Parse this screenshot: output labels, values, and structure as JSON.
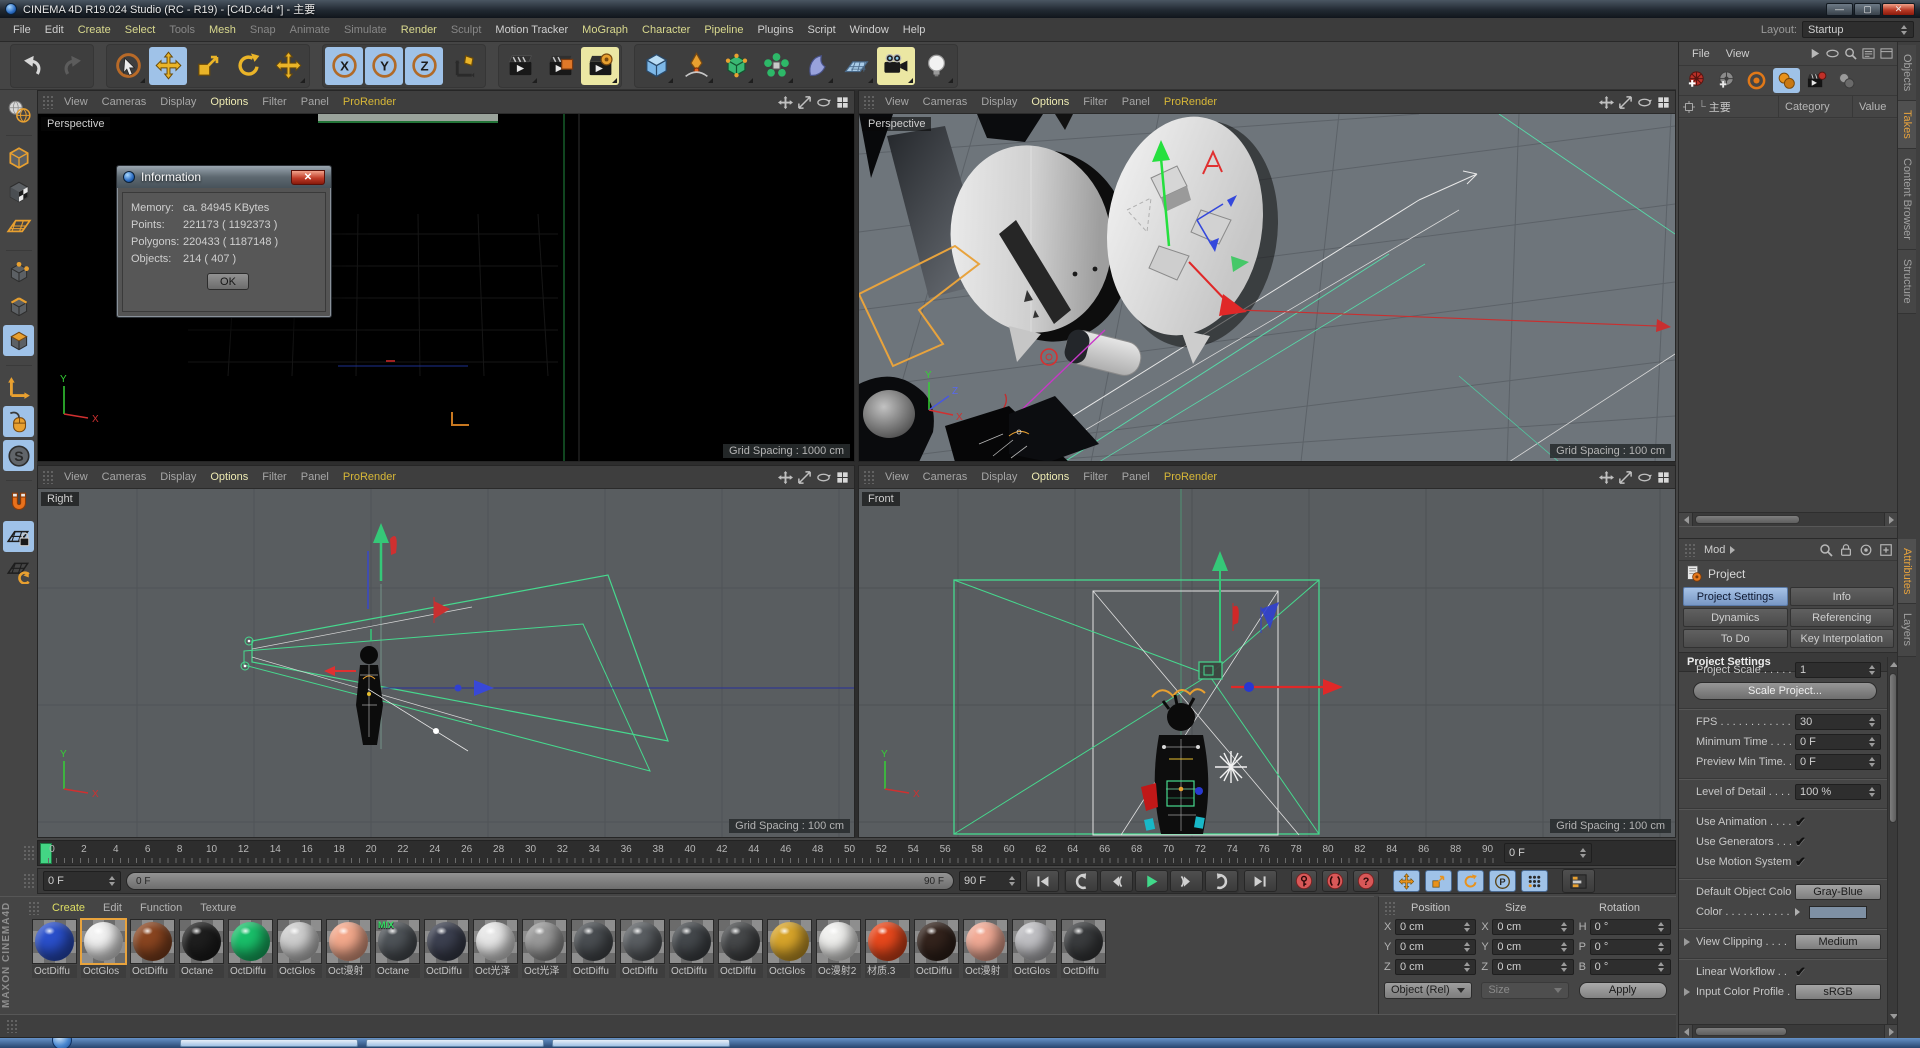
{
  "window": {
    "title": "CINEMA 4D R19.024 Studio (RC - R19) - [C4D.c4d *] - 主要",
    "menu": [
      {
        "label": "File",
        "tone": "normal"
      },
      {
        "label": "Edit",
        "tone": "normal"
      },
      {
        "label": "Create",
        "tone": "accent"
      },
      {
        "label": "Select",
        "tone": "accent"
      },
      {
        "label": "Tools",
        "tone": "dim"
      },
      {
        "label": "Mesh",
        "tone": "accent"
      },
      {
        "label": "Snap",
        "tone": "dim"
      },
      {
        "label": "Animate",
        "tone": "dim"
      },
      {
        "label": "Simulate",
        "tone": "dim"
      },
      {
        "label": "Render",
        "tone": "accent"
      },
      {
        "label": "Sculpt",
        "tone": "dim"
      },
      {
        "label": "Motion Tracker",
        "tone": "normal"
      },
      {
        "label": "MoGraph",
        "tone": "accent"
      },
      {
        "label": "Character",
        "tone": "accent"
      },
      {
        "label": "Pipeline",
        "tone": "accent"
      },
      {
        "label": "Plugins",
        "tone": "normal"
      },
      {
        "label": "Script",
        "tone": "normal"
      },
      {
        "label": "Window",
        "tone": "normal"
      },
      {
        "label": "Help",
        "tone": "normal"
      }
    ],
    "layout_label": "Layout:",
    "layout_value": "Startup",
    "controls": [
      "minimize",
      "maximize",
      "close"
    ]
  },
  "toolbar": {
    "groups": [
      [
        {
          "name": "undo"
        },
        {
          "name": "redo",
          "disabled": true
        }
      ],
      [
        {
          "name": "live-selection",
          "fly": true
        },
        {
          "name": "move",
          "active": true
        },
        {
          "name": "scale"
        },
        {
          "name": "rotate"
        },
        {
          "name": "last-tool",
          "fly": true
        }
      ],
      [
        {
          "name": "lock-x",
          "active": true
        },
        {
          "name": "lock-y",
          "active": true
        },
        {
          "name": "lock-z",
          "active": true
        },
        {
          "name": "coord-system"
        }
      ],
      [
        {
          "name": "render-view",
          "fly": true
        },
        {
          "name": "render-picture-viewer"
        },
        {
          "name": "render-settings",
          "accent": true,
          "fly": true
        }
      ],
      [
        {
          "name": "primitive-cube",
          "fly": true
        },
        {
          "name": "spline-pen",
          "fly": true
        },
        {
          "name": "subdivision-surface",
          "fly": true
        },
        {
          "name": "mograph",
          "fly": true
        },
        {
          "name": "deformer",
          "fly": true
        },
        {
          "name": "floor",
          "fly": true
        },
        {
          "name": "camera",
          "accent": true,
          "fly": true
        },
        {
          "name": "light",
          "fly": true
        }
      ]
    ]
  },
  "left_toolbar": [
    {
      "name": "make-editable"
    },
    {
      "sep": true
    },
    {
      "name": "model-mode"
    },
    {
      "name": "texture-mode"
    },
    {
      "name": "workplane-mode"
    },
    {
      "sep": true
    },
    {
      "name": "points-mode"
    },
    {
      "name": "edges-mode"
    },
    {
      "name": "polygons-mode",
      "active": true
    },
    {
      "sep": true
    },
    {
      "name": "axis-mode"
    },
    {
      "name": "viewport-interaction",
      "active": true
    },
    {
      "name": "snap",
      "active": true
    },
    {
      "sep": true
    },
    {
      "name": "magnet-snap"
    },
    {
      "name": "workplane-lock",
      "active": true
    },
    {
      "name": "planar-workplane"
    }
  ],
  "viewports": {
    "menu": [
      {
        "label": "View",
        "tone": "normal"
      },
      {
        "label": "Cameras",
        "tone": "normal"
      },
      {
        "label": "Display",
        "tone": "normal"
      },
      {
        "label": "Options",
        "tone": "bright"
      },
      {
        "label": "Filter",
        "tone": "normal"
      },
      {
        "label": "Panel",
        "tone": "normal"
      },
      {
        "label": "ProRender",
        "tone": "accent"
      }
    ],
    "corner_icons": [
      "pan-view",
      "zoom-view",
      "rotate-view",
      "toggle-view"
    ],
    "vp1": {
      "label": "Perspective",
      "grid": "Grid Spacing : 1000 cm",
      "axis_v": "Y",
      "axis_h": "X"
    },
    "vp2": {
      "label": "Perspective",
      "grid": "Grid Spacing : 100 cm",
      "axis_v": "Y",
      "axis_m": "Z",
      "axis_h": "X"
    },
    "vp3": {
      "label": "Right",
      "grid": "Grid Spacing : 100 cm",
      "axis_v": "Y",
      "axis_h": "X"
    },
    "vp4": {
      "label": "Front",
      "grid": "Grid Spacing : 100 cm",
      "axis_v": "Y",
      "axis_h": "X"
    }
  },
  "info_dialog": {
    "title": "Information",
    "rows": [
      {
        "label": "Memory:",
        "value": "ca. 84945 KBytes"
      },
      {
        "label": "Points:",
        "value": "221173 ( 1192373 )"
      },
      {
        "label": "Polygons:",
        "value": "220433 ( 1187148 )"
      },
      {
        "label": "Objects:",
        "value": "214 ( 407 )"
      }
    ],
    "ok": "OK"
  },
  "timeline": {
    "ticks": [
      0,
      2,
      4,
      6,
      8,
      10,
      12,
      14,
      16,
      18,
      20,
      22,
      24,
      26,
      28,
      30,
      32,
      34,
      36,
      38,
      40,
      42,
      44,
      46,
      48,
      50,
      52,
      54,
      56,
      58,
      60,
      62,
      64,
      66,
      68,
      70,
      72,
      74,
      76,
      78,
      80,
      82,
      84,
      86,
      88,
      90
    ],
    "ruler_spinner": "0 F",
    "frame_spinner": "0 F",
    "range_start": "0 F",
    "range_end": "90 F",
    "end_spinner": "90 F",
    "transport": [
      "go-to-start",
      "previous-key",
      "previous-frame",
      "play-forwards",
      "next-frame",
      "next-key",
      "go-to-end"
    ],
    "record": [
      "record-keyframe",
      "autokeying",
      "keying-options"
    ],
    "keying": [
      "key-position",
      "key-scale",
      "key-rotation",
      "key-parameter",
      "key-pla"
    ],
    "extra": "timeline-window"
  },
  "materials": {
    "logo": "MAXON CINEMA4D",
    "menu": [
      {
        "label": "Create",
        "tone": "accent"
      },
      {
        "label": "Edit",
        "tone": "normal"
      },
      {
        "label": "Function",
        "tone": "normal"
      },
      {
        "label": "Texture",
        "tone": "normal"
      }
    ],
    "items": [
      {
        "name": "OctDiffu",
        "color": "#2a50cc"
      },
      {
        "name": "OctGlos",
        "color": "#f2f2f2",
        "selected": true
      },
      {
        "name": "OctDiffu",
        "color": "#8a4520"
      },
      {
        "name": "Octane",
        "color": "#1e1e1e"
      },
      {
        "name": "OctDiffu",
        "color": "#19c06a"
      },
      {
        "name": "OctGlos",
        "color": "#cfcfcf"
      },
      {
        "name": "Oct漫射",
        "color": "#f4a98c"
      },
      {
        "name": "Octane",
        "color": "#4e5358",
        "badge": "MIX"
      },
      {
        "name": "OctDiffu",
        "color": "#3c4050"
      },
      {
        "name": "Oct光泽",
        "color": "#e8e8e8"
      },
      {
        "name": "Oct光泽",
        "color": "#9a9a9a"
      },
      {
        "name": "OctDiffu",
        "color": "#4a4e52"
      },
      {
        "name": "OctDiffu",
        "color": "#5a5e62"
      },
      {
        "name": "OctDiffu",
        "color": "#44484c"
      },
      {
        "name": "OctDiffu",
        "color": "#46484a"
      },
      {
        "name": "OctGlos",
        "color": "#d8a52a"
      },
      {
        "name": "Oc漫射2",
        "color": "#f0f0ee"
      },
      {
        "name": "材质.3",
        "color": "#e8481c"
      },
      {
        "name": "OctDiffu",
        "color": "#33231c"
      },
      {
        "name": "Oct漫射",
        "color": "#f2ab96"
      },
      {
        "name": "OctGlos",
        "color": "#c0c0c4"
      },
      {
        "name": "OctDiffu",
        "color": "#3a3c3e"
      }
    ]
  },
  "coords": {
    "headers": [
      "Position",
      "Size",
      "Rotation"
    ],
    "pos_axes": [
      "X",
      "Y",
      "Z"
    ],
    "size_axes": [
      "X",
      "Y",
      "Z"
    ],
    "rot_axes": [
      "H",
      "P",
      "B"
    ],
    "pos_values": [
      "0 cm",
      "0 cm",
      "0 cm"
    ],
    "size_values": [
      "0 cm",
      "0 cm",
      "0 cm"
    ],
    "rot_values": [
      "0 °",
      "0 °",
      "0 °"
    ],
    "mode": "Object (Rel)",
    "size_mode": "Size",
    "apply": "Apply"
  },
  "takes": {
    "menu": [
      "File",
      "View"
    ],
    "menu_icons": [
      "expand",
      "filter",
      "search",
      "list-view",
      "panel-menu"
    ],
    "icons": [
      {
        "name": "add-take"
      },
      {
        "name": "add-child-take"
      },
      {
        "name": "auto-take"
      },
      {
        "name": "current-take",
        "active": true
      },
      {
        "name": "render-marked-takes"
      },
      {
        "name": "manage-takes"
      }
    ],
    "root": "主要",
    "columns": [
      "Category",
      "Value"
    ]
  },
  "side_tabs_top": [
    {
      "label": "Objects"
    },
    {
      "label": "Takes",
      "active": true
    },
    {
      "label": "Content Browser"
    },
    {
      "label": "Structure"
    }
  ],
  "side_tabs_bottom": [
    {
      "label": "Attributes",
      "active": true
    },
    {
      "label": "Layers"
    }
  ],
  "attributes": {
    "mode": "Mod",
    "bar_icons": [
      "search",
      "lock",
      "focus",
      "add"
    ],
    "title": "Project",
    "tabs": [
      {
        "label": "Project Settings",
        "active": true
      },
      {
        "label": "Info"
      },
      {
        "label": "Dynamics"
      },
      {
        "label": "Referencing"
      },
      {
        "label": "To Do"
      },
      {
        "label": "Key Interpolation"
      }
    ],
    "section": "Project Settings",
    "fields": [
      {
        "label": "Project Scale . . . . . . .",
        "value": "1",
        "type": "spinner"
      },
      {
        "label": "Scale Project...",
        "type": "button"
      },
      {
        "type": "sep"
      },
      {
        "label": "FPS . . . . . . . . . . . . . .",
        "value": "30",
        "type": "spinner"
      },
      {
        "label": "Minimum Time . . . . .",
        "value": "0 F",
        "type": "spinner"
      },
      {
        "label": "Preview Min Time. . .",
        "value": "0 F",
        "type": "spinner"
      },
      {
        "type": "sep"
      },
      {
        "label": "Level of Detail . . . . . .",
        "value": "100 %",
        "type": "spinner"
      },
      {
        "type": "sep"
      },
      {
        "label": "Use Animation . . . . .",
        "type": "check",
        "checked": true
      },
      {
        "label": "Use Generators . . . . .",
        "type": "check",
        "checked": true
      },
      {
        "label": "Use Motion System",
        "type": "check",
        "checked": true
      },
      {
        "type": "sep"
      },
      {
        "label": "Default Object Color",
        "value": "Gray-Blue",
        "type": "dropdown"
      },
      {
        "label": "Color . . . . . . . . . . .",
        "type": "swatch",
        "swatch": "#7e90a4"
      },
      {
        "type": "sep"
      },
      {
        "label": "View Clipping . . . . . .",
        "value": "Medium",
        "type": "dropdown",
        "expander": true
      },
      {
        "type": "sep"
      },
      {
        "label": "Linear Workflow . . . .",
        "type": "check",
        "checked": true
      },
      {
        "label": "Input Color Profile . .",
        "value": "sRGB",
        "type": "dropdown",
        "expander": true
      }
    ]
  },
  "colors": {
    "accent_orange": "#e8a33d",
    "active_blue": "#9fc2e8",
    "play_green": "#43d584",
    "check": "✔"
  }
}
